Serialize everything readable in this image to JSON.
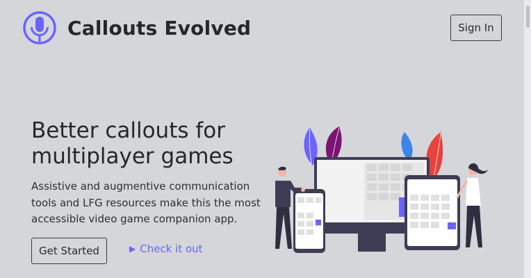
{
  "header": {
    "brand": "Callouts Evolved",
    "signin_label": "Sign In"
  },
  "hero": {
    "headline": "Better callouts for multiplayer games",
    "subtext": "Assistive and augmentive communication tools and LFG resources make this the most accessible video game companion app.",
    "get_started_label": "Get Started",
    "check_link_label": "Check it out"
  },
  "colors": {
    "accent": "#6c63ff",
    "background": "#d4d6d9",
    "dark": "#2f2e41"
  },
  "icons": {
    "logo": "microphone-icon",
    "link": "play-icon"
  }
}
